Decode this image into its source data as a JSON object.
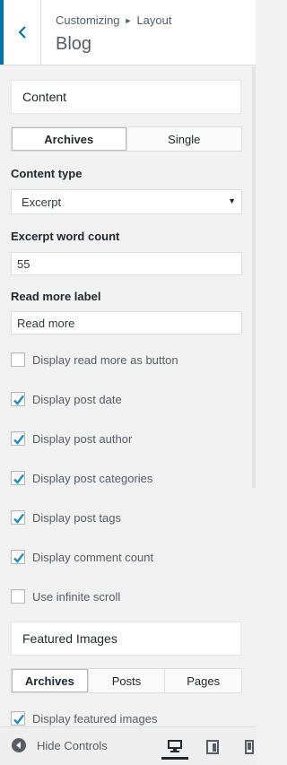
{
  "header": {
    "breadcrumb": [
      "Customizing",
      "Layout"
    ],
    "title": "Blog"
  },
  "content_section": {
    "title": "Content",
    "tabs": [
      {
        "label": "Archives",
        "active": true
      },
      {
        "label": "Single",
        "active": false
      }
    ],
    "content_type": {
      "label": "Content type",
      "value": "Excerpt"
    },
    "excerpt_count": {
      "label": "Excerpt word count",
      "value": "55"
    },
    "read_more": {
      "label": "Read more label",
      "value": "Read more"
    },
    "options": [
      {
        "label": "Display read more as button",
        "checked": false
      },
      {
        "label": "Display post date",
        "checked": true
      },
      {
        "label": "Display post author",
        "checked": true
      },
      {
        "label": "Display post categories",
        "checked": true
      },
      {
        "label": "Display post tags",
        "checked": true
      },
      {
        "label": "Display comment count",
        "checked": true
      },
      {
        "label": "Use infinite scroll",
        "checked": false
      }
    ]
  },
  "featured_section": {
    "title": "Featured Images",
    "tabs": [
      {
        "label": "Archives",
        "active": true
      },
      {
        "label": "Posts",
        "active": false
      },
      {
        "label": "Pages",
        "active": false
      }
    ],
    "options": [
      {
        "label": "Display featured images",
        "checked": true
      }
    ]
  },
  "footer": {
    "hide_controls": "Hide Controls",
    "devices": [
      "desktop-icon",
      "tablet-icon",
      "mobile-icon"
    ]
  },
  "colors": {
    "accent": "#0073aa",
    "check": "#1e8cbe"
  }
}
